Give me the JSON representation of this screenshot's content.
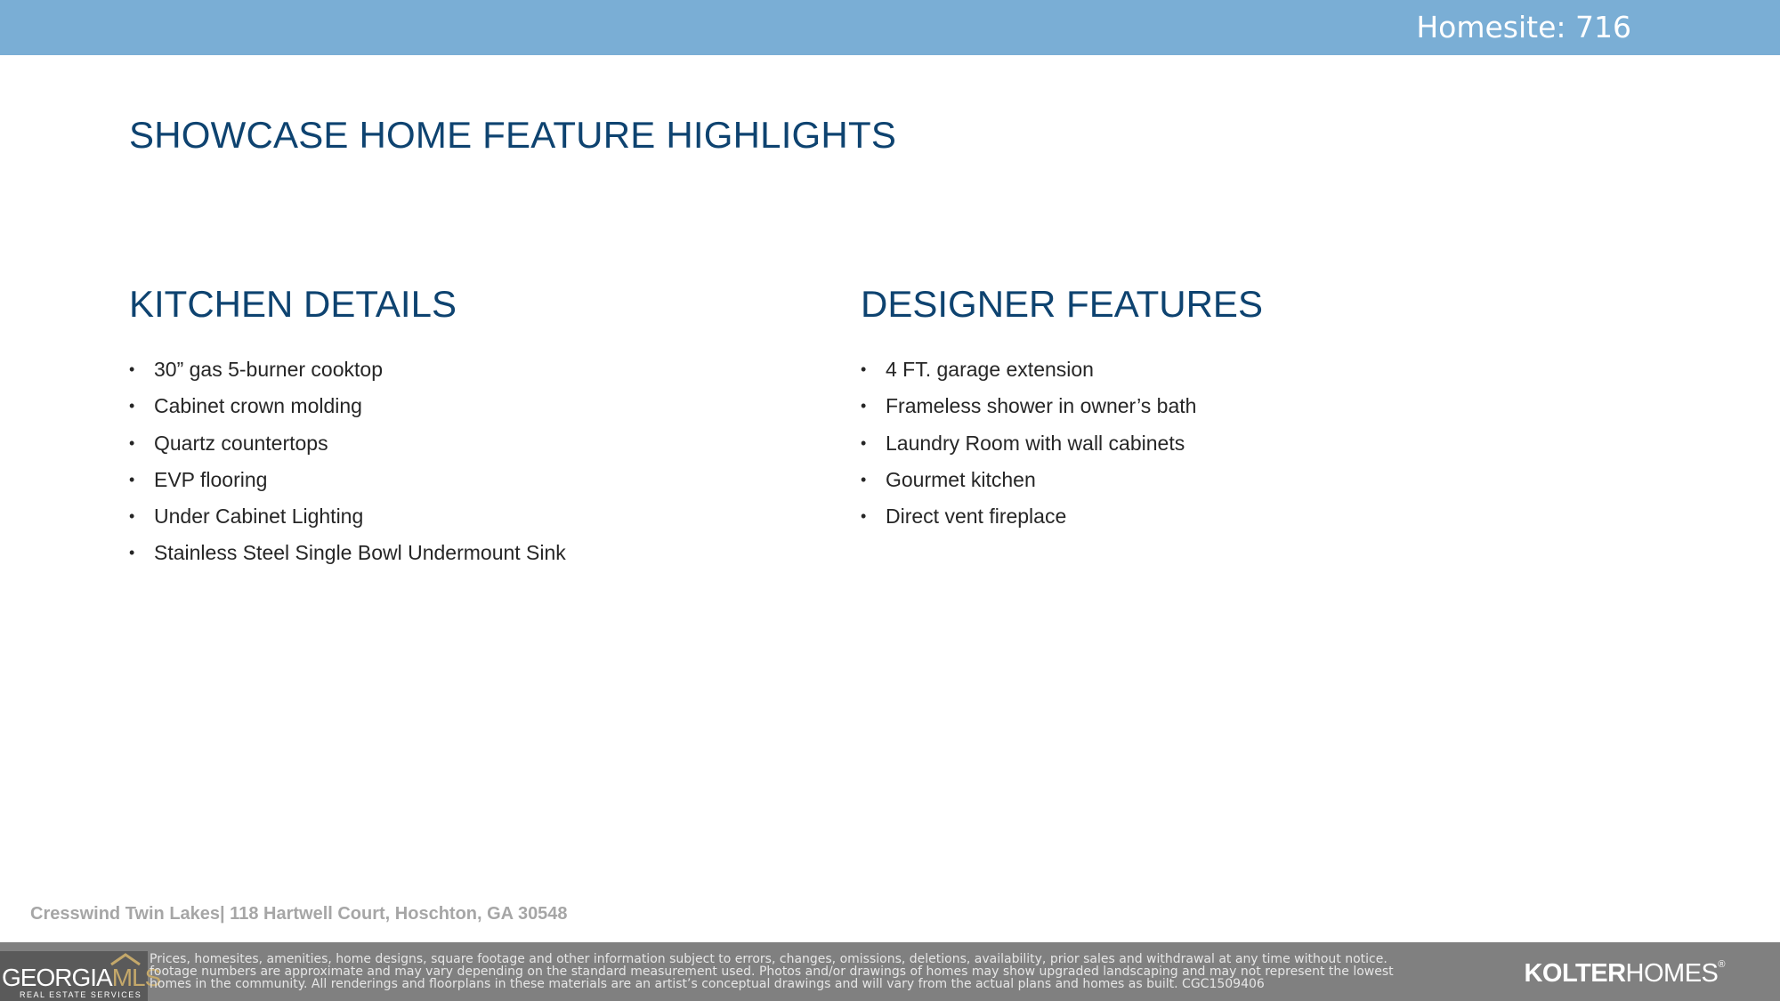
{
  "header": {
    "homesite_label": "Homesite: 716"
  },
  "title": "SHOWCASE HOME FEATURE HIGHLIGHTS",
  "sections": [
    {
      "heading": "KITCHEN DETAILS",
      "items": [
        "30” gas 5-burner cooktop",
        "Cabinet crown molding",
        "Quartz countertops",
        "EVP flooring",
        "Under Cabinet Lighting",
        "Stainless Steel Single Bowl Undermount Sink"
      ]
    },
    {
      "heading": "DESIGNER FEATURES",
      "items": [
        "4 FT. garage extension",
        "Frameless shower in owner’s bath",
        "Laundry Room with wall cabinets",
        "Gourmet kitchen",
        "Direct vent fireplace"
      ]
    }
  ],
  "bullet_glyph": "•",
  "footer": {
    "address": "Cresswind Twin Lakes| 118 Hartwell Court,  Hoschton, GA 30548",
    "disclaimer_lines": [
      "Prices, homesites, amenities, home designs, square footage and other information subject to errors, changes, omissions, deletions, availability, prior sales and withdrawal at any time without notice.",
      "footage numbers are approximate and may vary depending on the standard measurement used. Photos and/or drawings of homes may show upgraded landscaping and may not represent the lowest",
      "homes in the community. All renderings and floorplans in these materials are an artist’s conceptual drawings and will vary from the actual plans and homes as built. CGC1509406"
    ],
    "left_logo": {
      "word_main": "GEORGIA",
      "word_accent": "MLS",
      "tagline": "REAL ESTATE SERVICES"
    },
    "right_logo": {
      "word_bold": "KOLTER",
      "word_regular": "HOMES",
      "mark": "®"
    }
  },
  "colors": {
    "banner": "#7aaed5",
    "heading": "#0e4370",
    "body_text": "#262626",
    "address_text": "#a6a6a6",
    "footer_bar": "#808080",
    "mls_accent": "#c4a86a"
  }
}
